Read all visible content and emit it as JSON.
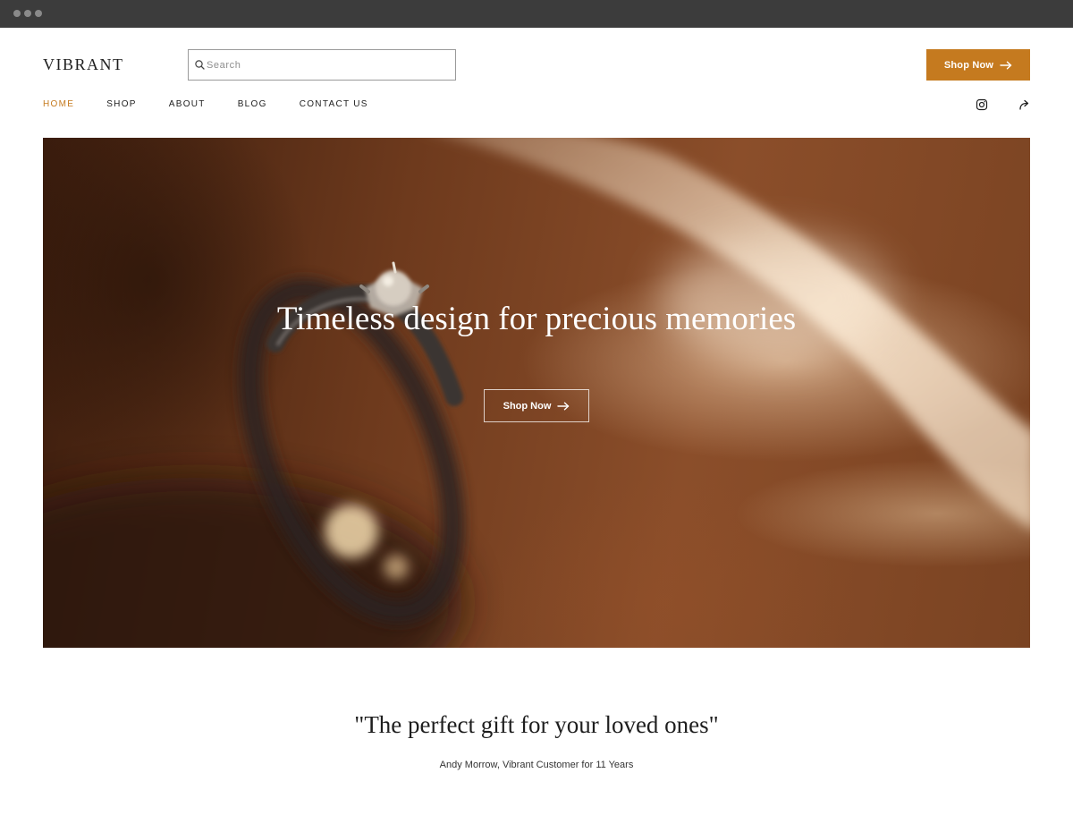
{
  "header": {
    "logo": "VIBRANT",
    "search": {
      "placeholder": "Search"
    },
    "cta_label": "Shop Now"
  },
  "nav": {
    "items": [
      {
        "label": "HOME",
        "active": true
      },
      {
        "label": "SHOP",
        "active": false
      },
      {
        "label": "ABOUT",
        "active": false
      },
      {
        "label": "BLOG",
        "active": false
      },
      {
        "label": "CONTACT US",
        "active": false
      }
    ]
  },
  "social": {
    "icons": [
      "instagram-icon",
      "share-icon"
    ]
  },
  "hero": {
    "title": "Timeless design for precious memories",
    "cta_label": "Shop Now",
    "image": "ring-photo"
  },
  "testimonial": {
    "quote": "\"The perfect gift for your loved ones\"",
    "author": "Andy Morrow, Vibrant Customer for 11 Years"
  },
  "colors": {
    "accent": "#c57a1f",
    "text": "#1e1e1e",
    "chrome": "#3c3c3c"
  }
}
